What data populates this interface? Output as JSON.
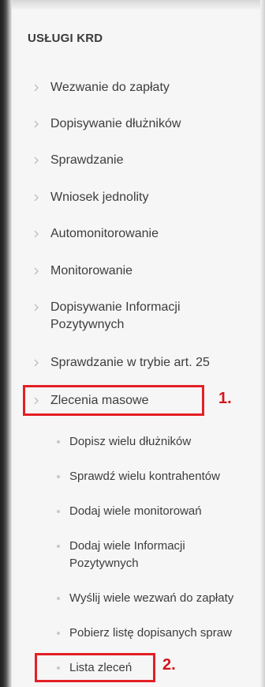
{
  "menu": {
    "title": "USŁUGI KRD",
    "items": [
      {
        "label": "Wezwanie do zapłaty"
      },
      {
        "label": "Dopisywanie dłużników"
      },
      {
        "label": "Sprawdzanie"
      },
      {
        "label": "Wniosek jednolity"
      },
      {
        "label": "Automonitorowanie"
      },
      {
        "label": "Monitorowanie"
      },
      {
        "label": "Dopisywanie Informacji Pozytywnych"
      },
      {
        "label": "Sprawdzanie w trybie art. 25"
      },
      {
        "label": "Zlecenia masowe"
      }
    ],
    "subitems": [
      {
        "label": "Dopisz wielu dłużników"
      },
      {
        "label": "Sprawdź wielu kontrahentów"
      },
      {
        "label": "Dodaj wiele monitorowań"
      },
      {
        "label": "Dodaj wiele Informacji Pozytywnych"
      },
      {
        "label": "Wyślij wiele wezwań do zapłaty"
      },
      {
        "label": "Pobierz listę dopisanych spraw"
      },
      {
        "label": "Lista zleceń"
      }
    ]
  },
  "annotations": {
    "marker_1": "1.",
    "marker_2": "2."
  },
  "colors": {
    "highlight": "#e32025",
    "marker_text": "#d3151b",
    "panel_bg": "#f6f6f6",
    "text": "#3d3d3d"
  }
}
